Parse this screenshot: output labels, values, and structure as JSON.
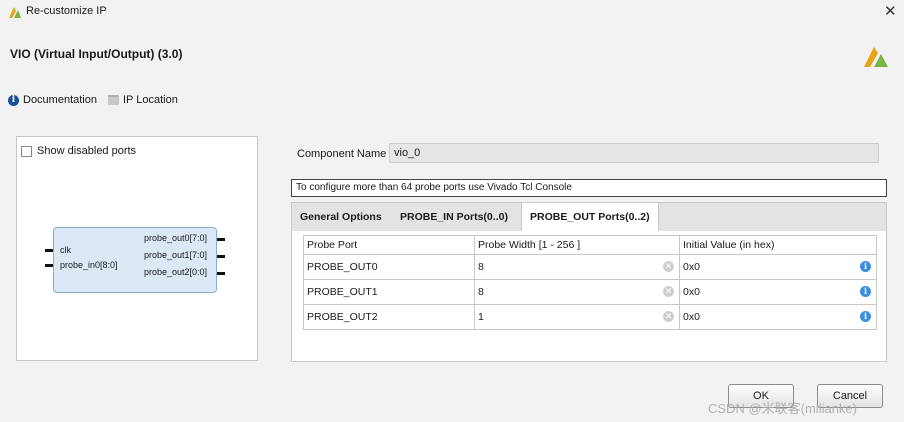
{
  "window": {
    "title": "Re-customize IP",
    "close_glyph": "✕"
  },
  "header": {
    "ip_title": "VIO (Virtual Input/Output) (3.0)",
    "documentation": "Documentation",
    "ip_location": "IP Location"
  },
  "left_panel": {
    "show_disabled_label": "Show disabled ports",
    "show_disabled_checked": false,
    "symbol": {
      "inputs": [
        "clk",
        "probe_in0[8:0]"
      ],
      "outputs": [
        "probe_out0[7:0]",
        "probe_out1[7:0]",
        "probe_out2[0:0]"
      ]
    }
  },
  "component": {
    "label": "Component Name",
    "value": "vio_0"
  },
  "info_text": "To configure more than 64 probe ports use Vivado Tcl Console",
  "tabs": [
    {
      "label": "General Options",
      "active": false
    },
    {
      "label": "PROBE_IN Ports(0..0)",
      "active": false
    },
    {
      "label": "PROBE_OUT Ports(0..2)",
      "active": true
    }
  ],
  "table": {
    "headers": [
      "Probe Port",
      "Probe Width [1 - 256 ]",
      "Initial Value (in hex)"
    ],
    "rows": [
      {
        "port": "PROBE_OUT0",
        "width": "8",
        "init": "0x0"
      },
      {
        "port": "PROBE_OUT1",
        "width": "8",
        "init": "0x0"
      },
      {
        "port": "PROBE_OUT2",
        "width": "1",
        "init": "0x0"
      }
    ]
  },
  "buttons": {
    "ok": "OK",
    "cancel": "Cancel"
  },
  "watermark": "CSDN @米联客(milianke)",
  "colors": {
    "brand_logo": "#e8a317",
    "brand_logo_green": "#7cb342",
    "info_icon": "#1a4f9c",
    "active_tab": "#ffffff",
    "tab_bar": "#e3e3e3"
  }
}
